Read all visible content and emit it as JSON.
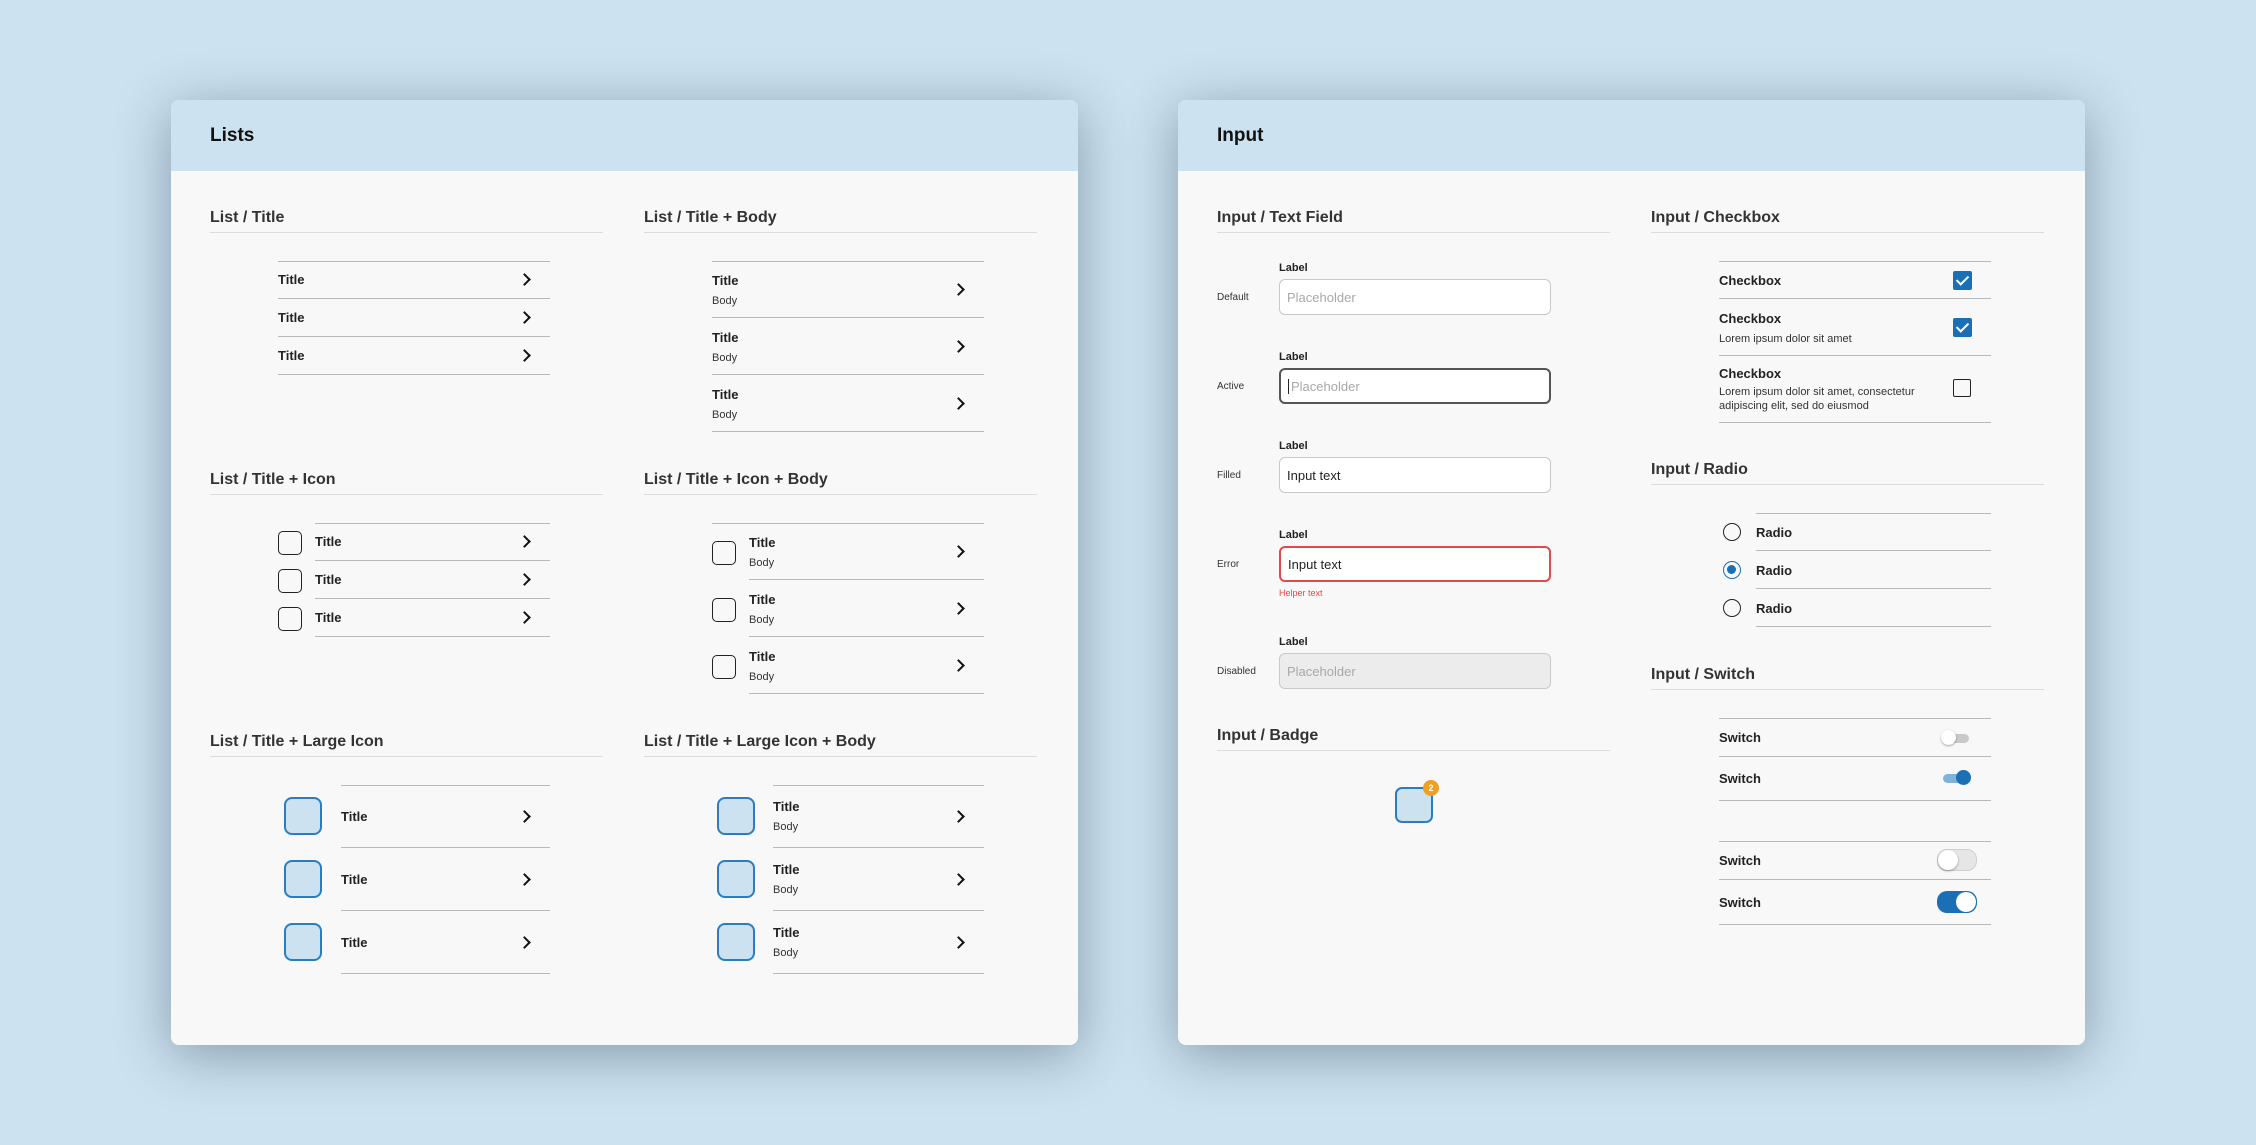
{
  "lists_panel": {
    "title": "Lists",
    "list_title": {
      "heading": "List / Title",
      "items": [
        {
          "title": "Title"
        },
        {
          "title": "Title"
        },
        {
          "title": "Title"
        }
      ]
    },
    "list_title_body": {
      "heading": "List / Title + Body",
      "items": [
        {
          "title": "Title",
          "body": "Body"
        },
        {
          "title": "Title",
          "body": "Body"
        },
        {
          "title": "Title",
          "body": "Body"
        }
      ]
    },
    "list_title_icon": {
      "heading": "List / Title + Icon",
      "items": [
        {
          "title": "Title"
        },
        {
          "title": "Title"
        },
        {
          "title": "Title"
        }
      ]
    },
    "list_title_icon_body": {
      "heading": "List / Title + Icon + Body",
      "items": [
        {
          "title": "Title",
          "body": "Body"
        },
        {
          "title": "Title",
          "body": "Body"
        },
        {
          "title": "Title",
          "body": "Body"
        }
      ]
    },
    "list_title_large_icon": {
      "heading": "List / Title + Large Icon",
      "items": [
        {
          "title": "Title"
        },
        {
          "title": "Title"
        },
        {
          "title": "Title"
        }
      ]
    },
    "list_title_large_icon_body": {
      "heading": "List / Title + Large Icon + Body",
      "items": [
        {
          "title": "Title",
          "body": "Body"
        },
        {
          "title": "Title",
          "body": "Body"
        },
        {
          "title": "Title",
          "body": "Body"
        }
      ]
    }
  },
  "input_panel": {
    "title": "Input",
    "text_field": {
      "heading": "Input / Text Field",
      "fields": [
        {
          "state": "Default",
          "label": "Label",
          "placeholder": "Placeholder",
          "value": ""
        },
        {
          "state": "Active",
          "label": "Label",
          "placeholder": "Placeholder",
          "value": ""
        },
        {
          "state": "Filled",
          "label": "Label",
          "placeholder": "",
          "value": "Input text"
        },
        {
          "state": "Error",
          "label": "Label",
          "placeholder": "",
          "value": "Input text",
          "helper": "Helper text"
        },
        {
          "state": "Disabled",
          "label": "Label",
          "placeholder": "Placeholder",
          "value": ""
        }
      ]
    },
    "badge": {
      "heading": "Input / Badge",
      "count": "2"
    },
    "checkbox": {
      "heading": "Input / Checkbox",
      "items": [
        {
          "title": "Checkbox",
          "body": "",
          "checked": true
        },
        {
          "title": "Checkbox",
          "body": "Lorem ipsum dolor sit amet",
          "checked": true
        },
        {
          "title": "Checkbox",
          "body_line1": "Lorem ipsum dolor sit amet, consectetur",
          "body_line2": "adipiscing elit, sed do eiusmod",
          "checked": false
        }
      ]
    },
    "radio": {
      "heading": "Input / Radio",
      "items": [
        {
          "label": "Radio",
          "selected": false
        },
        {
          "label": "Radio",
          "selected": true
        },
        {
          "label": "Radio",
          "selected": false
        }
      ]
    },
    "switch": {
      "heading": "Input / Switch",
      "items": [
        {
          "label": "Switch",
          "on": false,
          "size": "small"
        },
        {
          "label": "Switch",
          "on": true,
          "size": "small"
        },
        {
          "label": "Switch",
          "on": false,
          "size": "large"
        },
        {
          "label": "Switch",
          "on": true,
          "size": "large"
        }
      ]
    }
  },
  "colors": {
    "background": "#cce2f0",
    "panel_header": "#cce2f0",
    "panel_body": "#f8f8f8",
    "accent": "#1a6fb5",
    "error": "#e04a4a",
    "badge": "#f0a020"
  },
  "icons": [
    "chevron-right-icon",
    "checkbox-outline-icon",
    "check-icon"
  ]
}
